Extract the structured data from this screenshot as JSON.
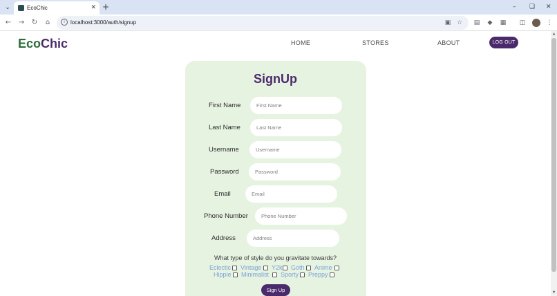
{
  "browser": {
    "tab_title": "EcoChic",
    "url": "localhost:3000/auth/signup"
  },
  "header": {
    "brand_part1": "Eco",
    "brand_part2": "Chic",
    "nav": [
      "HOME",
      "STORES",
      "ABOUT"
    ],
    "logout_label": "LOG OUT"
  },
  "form": {
    "title": "SignUp",
    "fields": [
      {
        "label": "First Name",
        "placeholder": "First Name",
        "value": ""
      },
      {
        "label": "Last Name",
        "placeholder": "Last Name",
        "value": ""
      },
      {
        "label": "Username",
        "placeholder": "Username",
        "value": ""
      },
      {
        "label": "Password",
        "placeholder": "Password",
        "value": ""
      },
      {
        "label": "Email",
        "placeholder": "Email",
        "value": ""
      },
      {
        "label": "Phone Number",
        "placeholder": "Phone Number",
        "value": ""
      },
      {
        "label": "Address",
        "placeholder": "Address",
        "value": ""
      }
    ],
    "style_question": "What type of style do you gravitate towards?",
    "style_options": [
      "Eclectic",
      "Vintage",
      "Y2k",
      "Goth",
      "Anime",
      "Hippie",
      "Minimalist",
      "Sporty",
      "Preppy"
    ],
    "submit_label": "Sign Up"
  },
  "colors": {
    "accent": "#4b2a6b",
    "brand_green": "#2e6b3a",
    "card_bg": "#e7f3e1",
    "option_text": "#7aa3d6"
  }
}
